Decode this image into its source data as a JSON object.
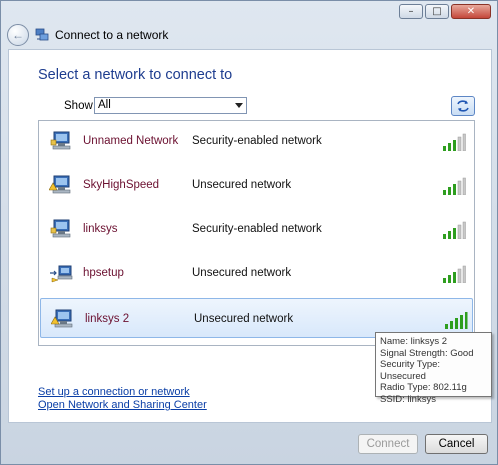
{
  "window": {
    "title": "Connect to a network",
    "buttons": {
      "minimize": "–",
      "maximize": "□",
      "close": "✕"
    },
    "back_glyph": "←"
  },
  "main": {
    "heading": "Select a network to connect to",
    "show_label": "Show",
    "show_value": "All"
  },
  "networks": [
    {
      "name": "Unnamed Network",
      "security": "Security-enabled network",
      "icon": "secured-network-icon",
      "signal_bars": 5
    },
    {
      "name": "SkyHighSpeed",
      "security": "Unsecured network",
      "icon": "unsecured-network-icon",
      "signal_bars": 5
    },
    {
      "name": "linksys",
      "security": "Security-enabled network",
      "icon": "secured-network-icon",
      "signal_bars": 5
    },
    {
      "name": "hpsetup",
      "security": "Unsecured network",
      "icon": "adhoc-network-icon",
      "signal_bars": 5
    },
    {
      "name": "linksys 2",
      "security": "Unsecured network",
      "icon": "unsecured-network-icon",
      "signal_bars": 5,
      "selected": true
    }
  ],
  "tooltip": {
    "name": "Name: linksys 2",
    "signal": "Signal Strength: Good",
    "security": "Security Type: Unsecured",
    "radio": "Radio Type: 802.11g",
    "ssid": "SSID: linksys"
  },
  "links": {
    "setup": "Set up a connection or network",
    "sharing": "Open Network and Sharing Center"
  },
  "footer": {
    "connect": "Connect",
    "cancel": "Cancel"
  },
  "colors": {
    "signal_green": "#2e9e1f",
    "heading_blue": "#1e3d8f",
    "link_blue": "#0a3ea6",
    "name_maroon": "#6b1030"
  }
}
